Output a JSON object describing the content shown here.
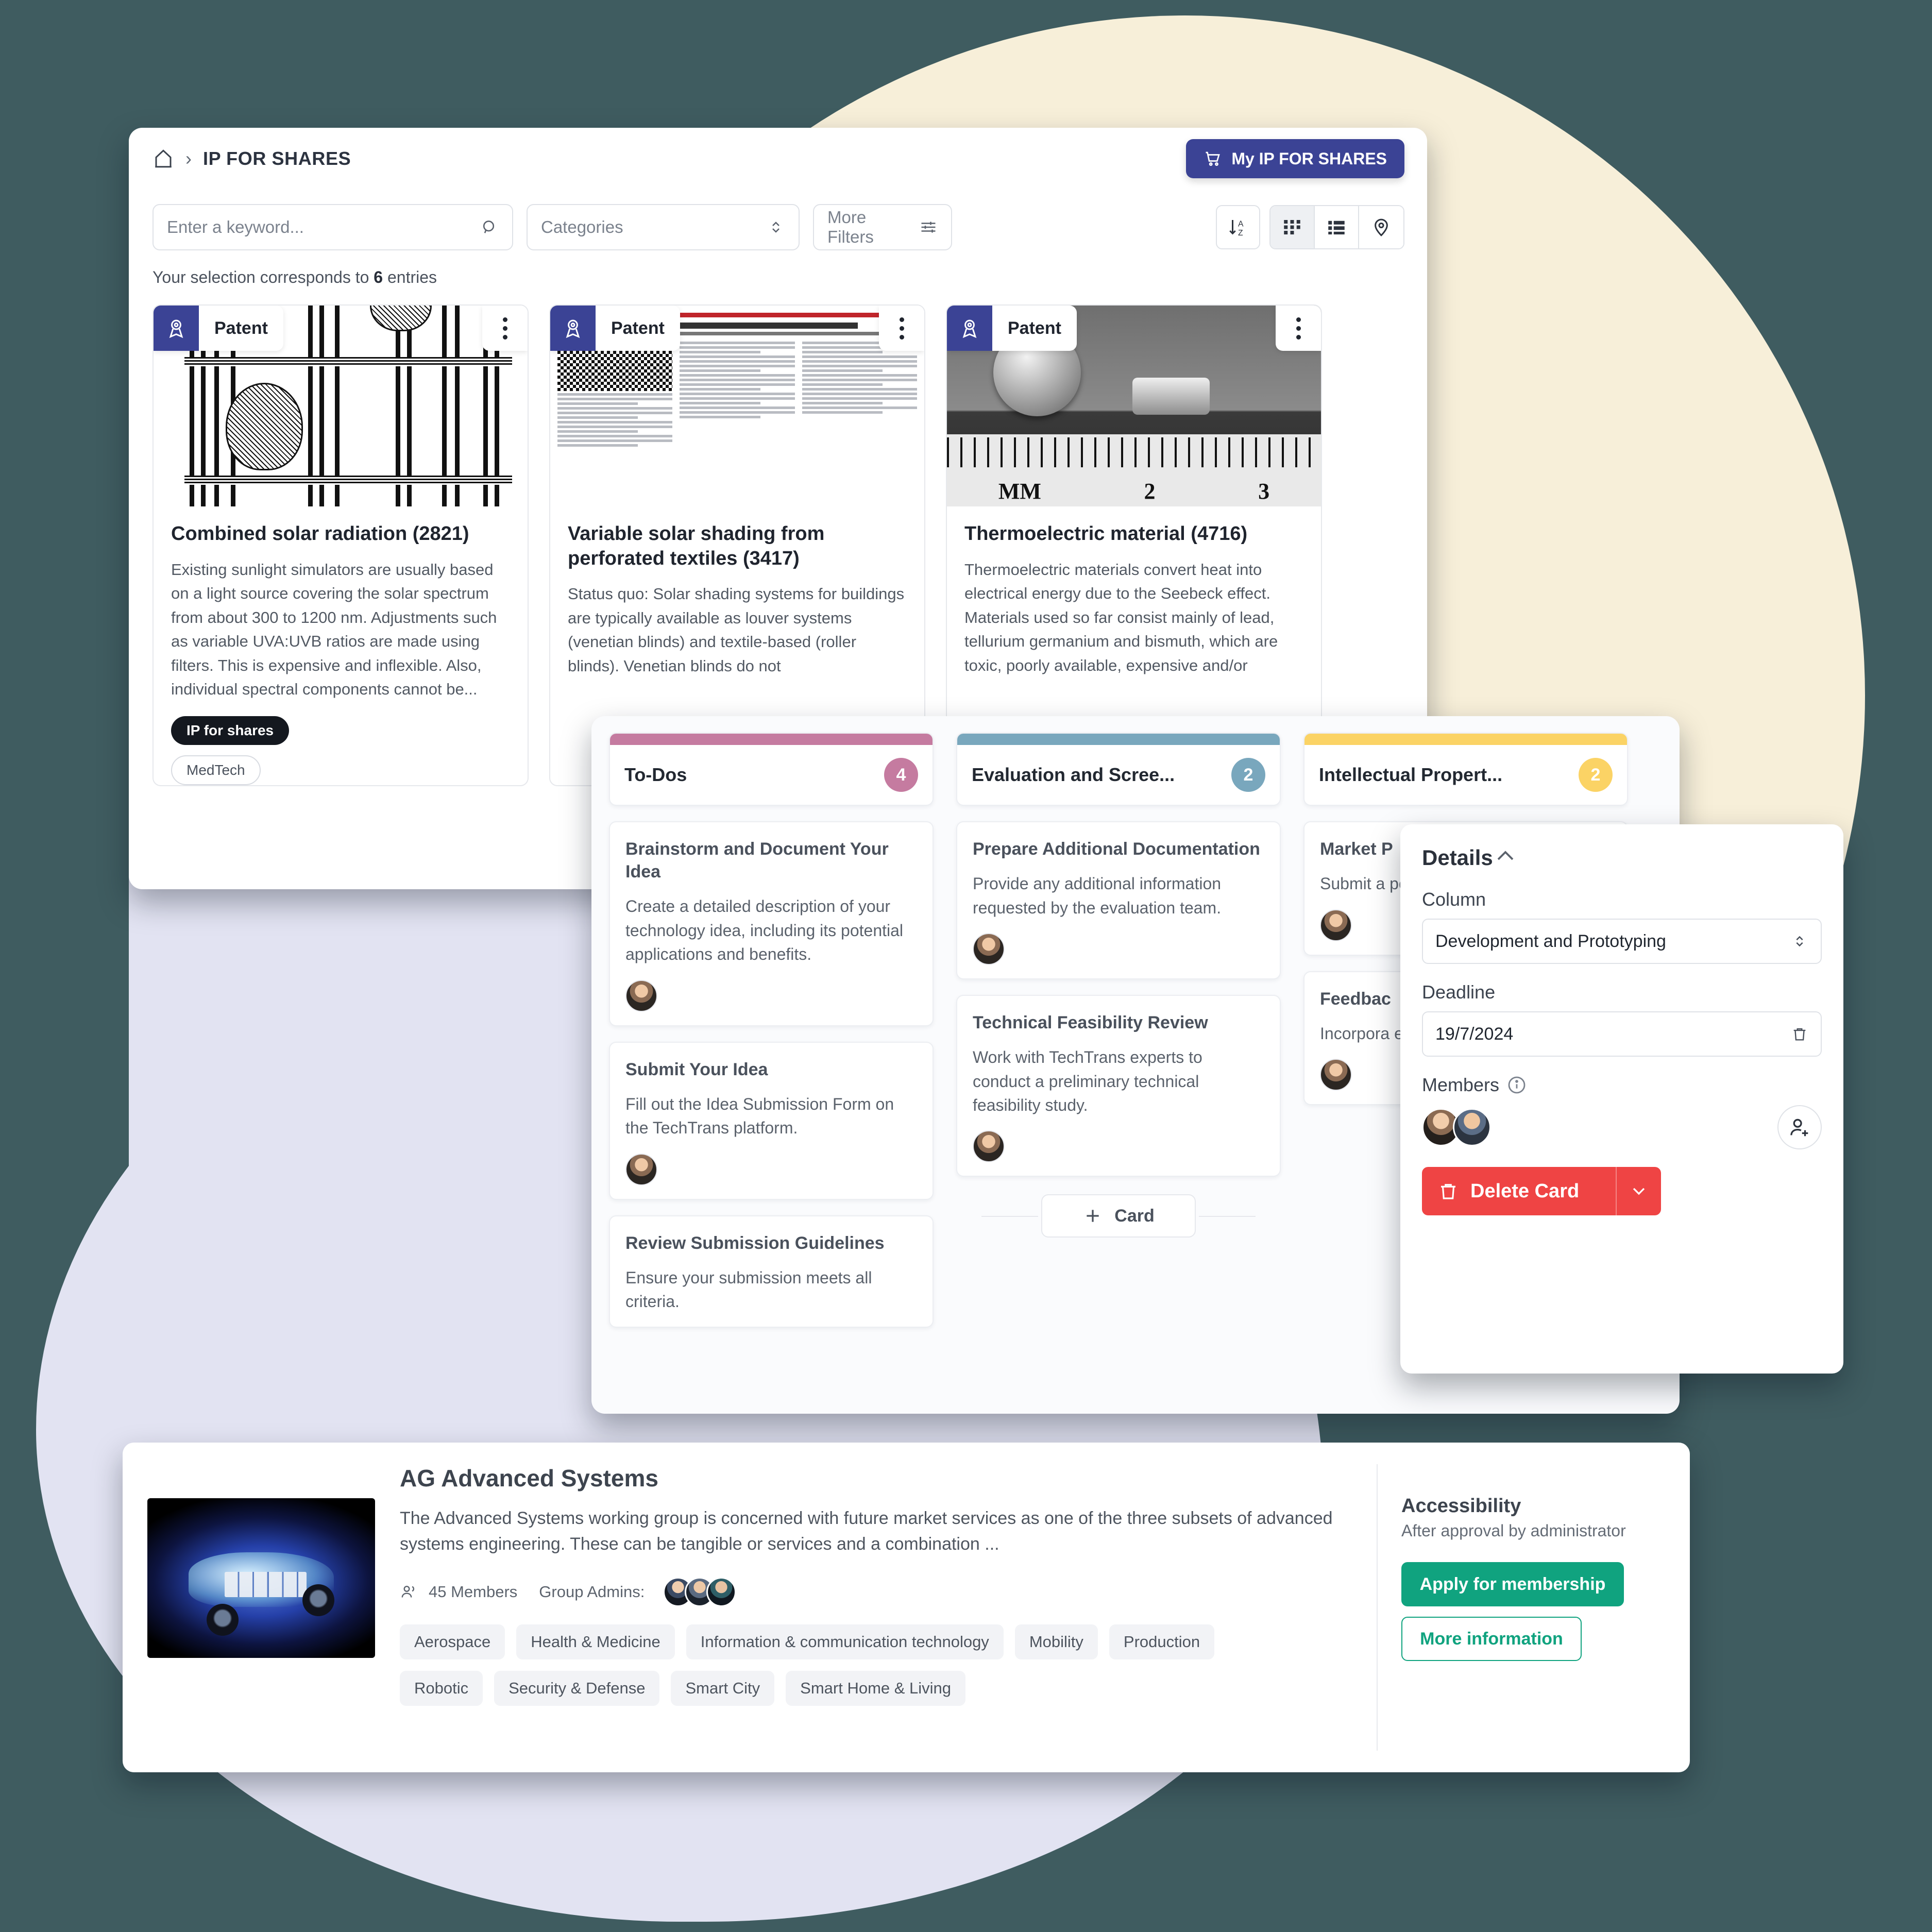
{
  "background": {
    "base_color": "#3f5c60",
    "cream_color": "#f7efd9",
    "lavender_color": "#e2e3f2"
  },
  "ip_window": {
    "breadcrumb": {
      "home_icon": "home-icon",
      "separator": "›",
      "title": "IP FOR SHARES"
    },
    "cart_button": {
      "label": "My IP FOR SHARES",
      "icon": "shopping-cart-icon",
      "color": "#3b4395"
    },
    "search": {
      "placeholder": "Enter a keyword...",
      "icon": "search-icon"
    },
    "categories": {
      "value": "Categories",
      "icon": "chevron-updown-icon"
    },
    "more_filters": {
      "label": "More Filters",
      "icon": "sliders-icon"
    },
    "view_tools": {
      "sort": "sort-az-icon",
      "grid": "grid-view-icon",
      "list": "list-view-icon",
      "map": "map-pin-icon"
    },
    "result_text_prefix": "Your selection corresponds to ",
    "result_count": "6",
    "result_text_suffix": " entries",
    "cards": [
      {
        "badge": "Patent",
        "badge_icon": "award-ribbon-icon",
        "menu_icon": "kebab-menu-icon",
        "title": "Combined solar radiation (2821)",
        "description": "Existing sunlight simulators are usually based on a light source covering the solar spectrum from about 300 to 1200 nm. Adjustments such as variable UVA:UVB ratios are made using filters. This is expensive and inflexible. Also, individual spectral components cannot be...",
        "tag_primary": "IP for shares",
        "tag_secondary": "MedTech"
      },
      {
        "badge": "Patent",
        "badge_icon": "award-ribbon-icon",
        "menu_icon": "kebab-menu-icon",
        "title": "Variable solar shading from perforated textiles (3417)",
        "description": "Status quo: Solar shading systems for buildings are typically available as louver systems (venetian blinds) and textile-based (roller blinds). Venetian blinds do not",
        "thumb_heading": "…nschutz aus perforierten Textilien",
        "thumb_sub": "Innovatives Sonnenschutzsystem ermöglicht variable Lichttransmission durch Nutzung textiler Gelenke"
      },
      {
        "badge": "Patent",
        "badge_icon": "award-ribbon-icon",
        "menu_icon": "kebab-menu-icon",
        "title": "Thermoelectric material (4716)",
        "description": "Thermoelectric materials convert heat into electrical energy due to the Seebeck effect. Materials used so far consist mainly of lead, tellurium germanium and bismuth, which are toxic, poorly available, expensive and/or"
      }
    ]
  },
  "kanban": {
    "add_card_label": "Card",
    "add_card_icon": "plus-icon",
    "columns": [
      {
        "title": "To-Dos",
        "count": "4",
        "color": "#c57ba0",
        "cards": [
          {
            "title": "Brainstorm and Document Your Idea",
            "description": "Create a detailed description of your technology idea, including its potential applications and benefits.",
            "avatar": "member-avatar"
          },
          {
            "title": "Submit Your Idea",
            "description": "Fill out the Idea Submission Form on the TechTrans platform.",
            "avatar": "member-avatar"
          },
          {
            "title": "Review Submission Guidelines",
            "description": "Ensure your submission meets all criteria.",
            "avatar": "member-avatar"
          }
        ]
      },
      {
        "title": "Evaluation and Scree...",
        "count": "2",
        "color": "#79a7bd",
        "cards": [
          {
            "title": "Prepare Additional Documentation",
            "description": "Provide any additional information requested by the evaluation team.",
            "avatar": "member-avatar"
          },
          {
            "title": "Technical Feasibility Review",
            "description": "Work with TechTrans experts to conduct a preliminary technical feasibility study.",
            "avatar": "member-avatar"
          }
        ]
      },
      {
        "title": "Intellectual Propert...",
        "count": "2",
        "color": "#fbd365",
        "cards": [
          {
            "title": "Market P",
            "description": "Submit a potential",
            "avatar": "member-avatar"
          },
          {
            "title": "Feedbac",
            "description": "Incorpora evaluatio idea.",
            "avatar": "member-avatar"
          }
        ]
      }
    ]
  },
  "details": {
    "title": "Details",
    "collapse_icon": "chevron-up-icon",
    "column_label": "Column",
    "column_value": "Development and Prototyping",
    "column_icon": "chevron-updown-icon",
    "deadline_label": "Deadline",
    "deadline_value": "19/7/2024",
    "deadline_icon": "trash-icon",
    "members_label": "Members",
    "members_info_icon": "info-icon",
    "add_member_icon": "add-user-icon",
    "delete_label": "Delete Card",
    "delete_icon": "trash-icon",
    "delete_caret_icon": "chevron-down-icon",
    "delete_color": "#ef4444"
  },
  "ag_group": {
    "thumbnail": "electric-vehicle-platform-image",
    "title": "AG Advanced Systems",
    "description": "The Advanced Systems working group is concerned with future market services as one of the three subsets of advanced systems engineering. These can be tangible or services and a combination ...",
    "members_icon": "members-icon",
    "members_count": "45 Members",
    "admins_label": "Group Admins:",
    "chips": [
      "Aerospace",
      "Health & Medicine",
      "Information & communication technology",
      "Mobility",
      "Production",
      "Robotic",
      "Security & Defense",
      "Smart City",
      "Smart Home & Living"
    ],
    "accessibility_title": "Accessibility",
    "accessibility_sub": "After approval by administrator",
    "apply_label": "Apply for membership",
    "more_info_label": "More information",
    "accent_color": "#10a37f"
  }
}
